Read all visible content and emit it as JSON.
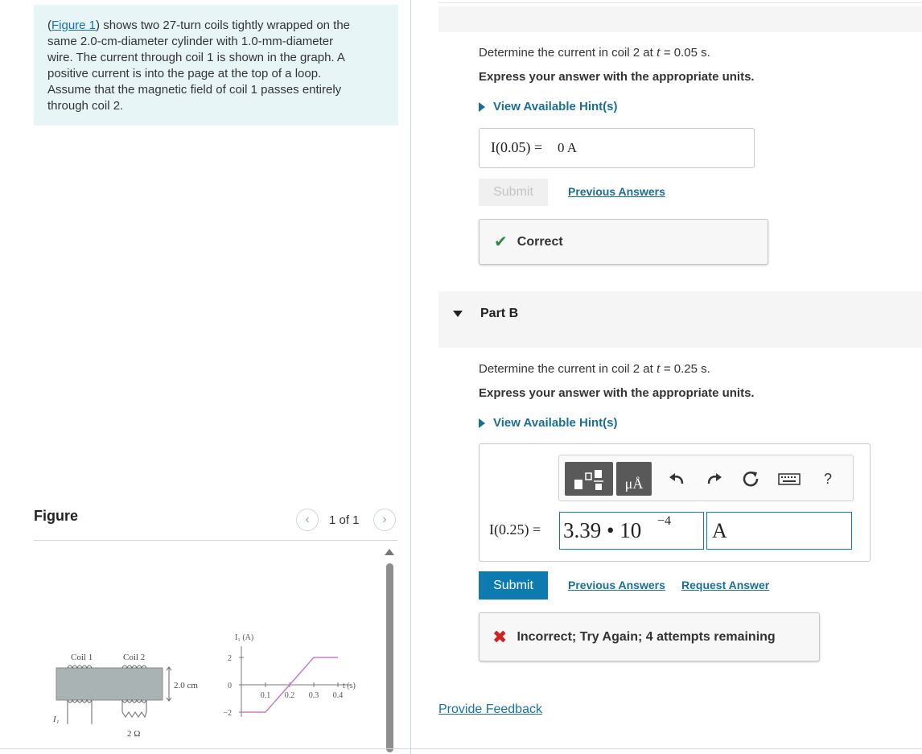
{
  "problem": {
    "figure_link": "Figure 1",
    "text_lines": [
      ") shows two 27-turn coils tightly wrapped on the",
      "same 2.0-cm-diameter cylinder with 1.0-mm-diameter",
      "wire. The current through coil 1 is shown in the graph. A",
      "positive current is into the page at the top of a loop.",
      "Assume that the magnetic field of coil 1 passes entirely",
      "through coil 2."
    ]
  },
  "figure_panel": {
    "heading": "Figure",
    "counter": "1 of 1",
    "prev_icon": "chevron-left-icon",
    "next_icon": "chevron-right-icon"
  },
  "figure": {
    "coil1_label": "Coil 1",
    "coil2_label": "Coil 2",
    "diameter_label": "2.0 cm",
    "resistor_label": "2 Ω",
    "current_label": "I₁",
    "graph": {
      "ylabel": "I₁ (A)",
      "xlabel": "t (s)",
      "y_ticks": [
        "2",
        "0",
        "−2"
      ],
      "x_ticks": [
        "0.1",
        "0.2",
        "0.3",
        "0.4"
      ]
    }
  },
  "chart_data": {
    "type": "line",
    "x": [
      0.0,
      0.1,
      0.3,
      0.4
    ],
    "values": [
      -2,
      -2,
      2,
      2
    ],
    "xlabel": "t (s)",
    "ylabel": "I₁ (A)",
    "xlim": [
      0,
      0.45
    ],
    "ylim": [
      -2,
      2
    ],
    "color": "#c77dc8"
  },
  "part_a": {
    "question_prefix": "Determine the current in coil 2 at ",
    "question_var": "t",
    "question_suffix": " = 0.05 s.",
    "instruction": "Express your answer with the appropriate units.",
    "hint_link": "View Available Hint(s)",
    "answer_lhs": "I(0.05) =",
    "answer_value": "0 A",
    "submit_label": "Submit",
    "previous_answers": "Previous Answers",
    "feedback": "Correct",
    "feedback_color": "#2d8a3e"
  },
  "part_b": {
    "title": "Part B",
    "question_prefix": "Determine the current in coil 2 at ",
    "question_var": "t",
    "question_suffix": " = 0.25 s.",
    "instruction": "Express your answer with the appropriate units.",
    "hint_link": "View Available Hint(s)",
    "toolbar": {
      "units_label": "μÅ",
      "help_label": "?",
      "icons": [
        "templates-icon",
        "units-icon",
        "undo-icon",
        "redo-icon",
        "reset-icon",
        "keyboard-icon",
        "help-icon"
      ]
    },
    "answer_lhs": "I(0.25) =",
    "answer_mantissa": "3.39 • 10",
    "answer_exponent": "−4",
    "answer_unit": "A",
    "submit_label": "Submit",
    "previous_answers": "Previous Answers",
    "request_answer": "Request Answer",
    "feedback": "Incorrect; Try Again; 4 attempts remaining",
    "feedback_color": "#cc2222"
  },
  "provide_feedback": "Provide Feedback",
  "colors": {
    "accent": "#0e7bb0",
    "link": "#1a6f95",
    "problem_bg": "#e8f5f7"
  }
}
